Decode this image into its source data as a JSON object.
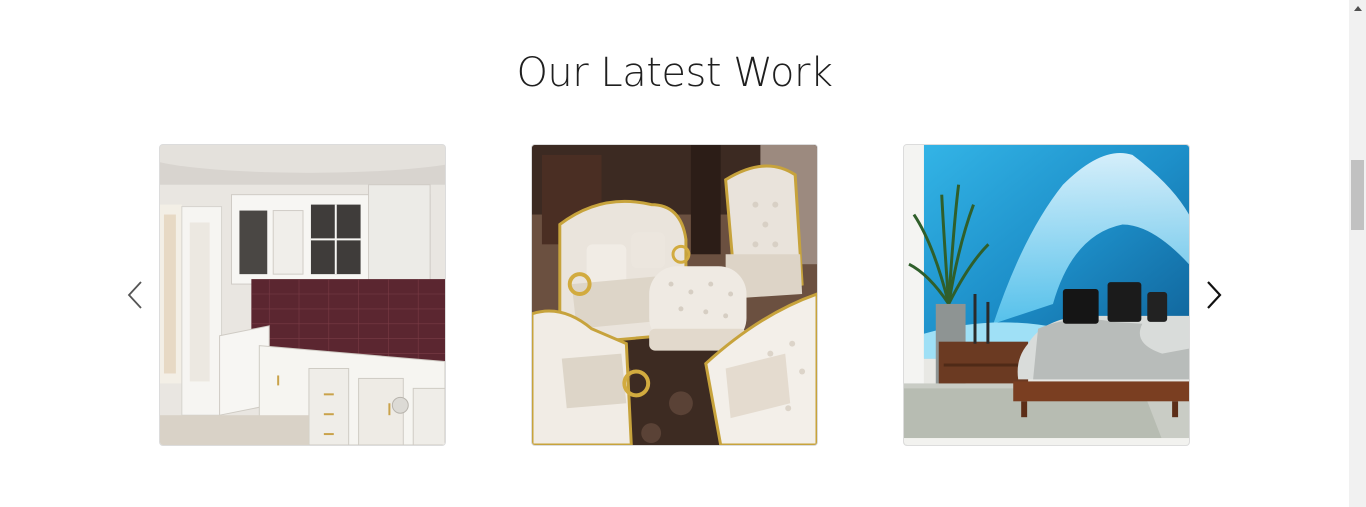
{
  "section": {
    "title": "Our Latest Work"
  },
  "carousel": {
    "prev_icon": "chevron-left-icon",
    "next_icon": "chevron-right-icon",
    "slides": [
      {
        "subject": "white-kitchen-cabinets-photo"
      },
      {
        "subject": "cream-gold-sofa-set-photo"
      },
      {
        "subject": "ocean-wave-bedroom-photo"
      }
    ]
  },
  "colors": {
    "title": "#1f1f1f",
    "arrow": "#555555",
    "arrow_active": "#111111",
    "scrollbar_track": "#f1f1f1",
    "scrollbar_thumb": "#c1c1c1"
  }
}
